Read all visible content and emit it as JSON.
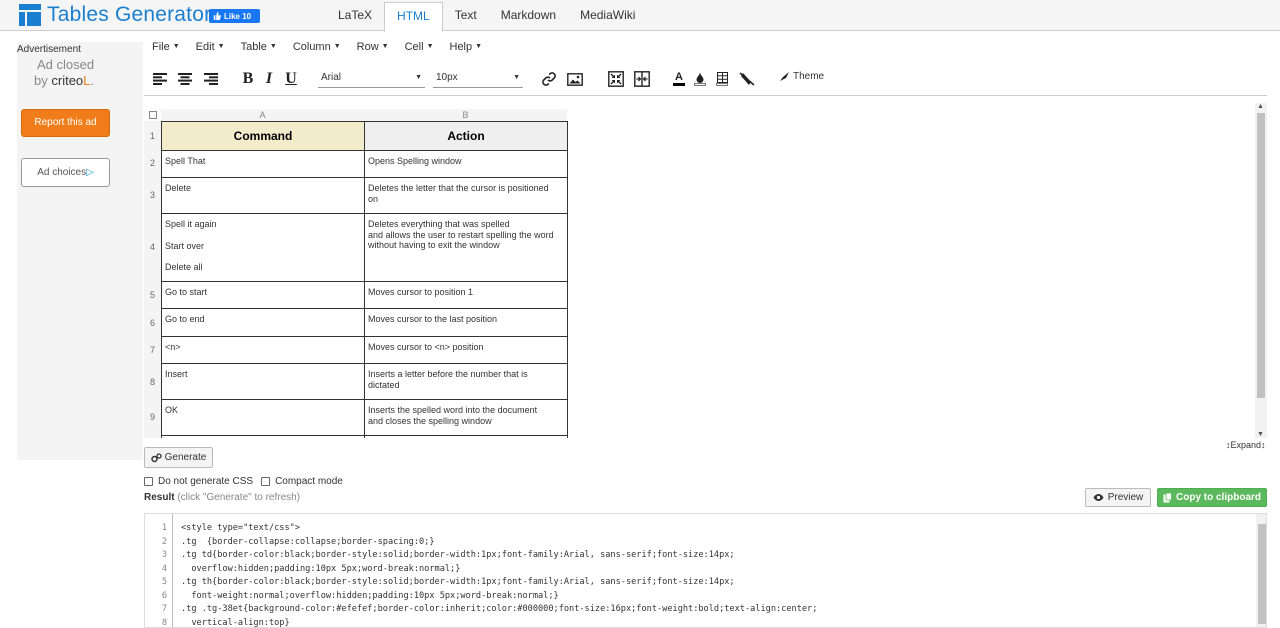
{
  "app": {
    "title": "Tables Generator",
    "like_label": "Like 10",
    "tabs": [
      {
        "label": "LaTeX",
        "active": false
      },
      {
        "label": "HTML",
        "active": true
      },
      {
        "label": "Text",
        "active": false
      },
      {
        "label": "Markdown",
        "active": false
      },
      {
        "label": "MediaWiki",
        "active": false
      }
    ]
  },
  "ad": {
    "title": "Advertisement",
    "closed": "Ad closed",
    "by": "by",
    "brand": "criteo",
    "report": "Report this ad",
    "choices": "Ad choices"
  },
  "menu": [
    "File",
    "Edit",
    "Table",
    "Column",
    "Row",
    "Cell",
    "Help"
  ],
  "toolbar": {
    "font": "Arial",
    "size": "10px",
    "theme": "Theme",
    "icons": [
      "align-left-icon",
      "align-center-icon",
      "align-right-icon",
      "bold-icon",
      "italic-icon",
      "underline-icon",
      "link-icon",
      "image-icon",
      "merge-cells-icon",
      "split-cells-icon",
      "text-color-icon",
      "fill-color-icon",
      "border-icon",
      "clear-format-icon",
      "theme-icon"
    ],
    "bold": "B",
    "italic": "I",
    "underline": "U",
    "text_color": "A"
  },
  "sheet": {
    "columns": [
      "A",
      "B"
    ],
    "rows": [
      {
        "num": "1",
        "a": "Command",
        "b": "Action"
      },
      {
        "num": "2",
        "a": "Spell That",
        "b": "Opens Spelling window"
      },
      {
        "num": "3",
        "a": "Delete",
        "b": "Deletes the letter that the cursor is positioned on"
      },
      {
        "num": "4",
        "a_lines": [
          "Spell it again",
          "Start over",
          "Delete all"
        ],
        "b": "Deletes everything that was spelled and allows the user to restart spelling the word without having to exit the window"
      },
      {
        "num": "5",
        "a": "Go to start",
        "b": "Moves cursor to position 1"
      },
      {
        "num": "6",
        "a": "Go to end",
        "b": "Moves cursor to the last position"
      },
      {
        "num": "7",
        "a": "<n>",
        "b": "Moves cursor to <n> position"
      },
      {
        "num": "8",
        "a": "Insert",
        "b": "Inserts a letter before the number that is dictated"
      },
      {
        "num": "9",
        "a": "OK",
        "b": "Inserts the spelled word into the document and closes the spelling window"
      }
    ],
    "row4_b_lines": [
      "Deletes everything that was spelled",
      "and allows the user to restart spelling the word",
      "without having to exit the window"
    ],
    "row3_b_lines": [
      "Deletes the letter that the cursor is positioned",
      "on"
    ],
    "row8_b_lines": [
      "Inserts a letter before the number that is",
      "dictated"
    ],
    "row9_b_lines": [
      "Inserts the spelled word into the document",
      "and closes the spelling window"
    ]
  },
  "expand": "Expand",
  "generate": "Generate",
  "options": {
    "no_css": "Do not generate CSS",
    "compact": "Compact mode"
  },
  "result": {
    "label": "Result",
    "hint": "(click \"Generate\" to refresh)"
  },
  "buttons": {
    "preview": "Preview",
    "copy": "Copy to clipboard"
  },
  "code_lines": [
    {
      "n": "1",
      "t": "<style type=\"text/css\">"
    },
    {
      "n": "2",
      "t": ".tg  {border-collapse:collapse;border-spacing:0;}"
    },
    {
      "n": "3",
      "t": ".tg td{border-color:black;border-style:solid;border-width:1px;font-family:Arial, sans-serif;font-size:14px;"
    },
    {
      "n": "4",
      "t": "  overflow:hidden;padding:10px 5px;word-break:normal;}"
    },
    {
      "n": "5",
      "t": ".tg th{border-color:black;border-style:solid;border-width:1px;font-family:Arial, sans-serif;font-size:14px;"
    },
    {
      "n": "6",
      "t": "  font-weight:normal;overflow:hidden;padding:10px 5px;word-break:normal;}"
    },
    {
      "n": "7",
      "t": ".tg .tg-38et{background-color:#efefef;border-color:inherit;color:#000000;font-size:16px;font-weight:bold;text-align:center;"
    },
    {
      "n": "8",
      "t": "  vertical-align:top}"
    }
  ],
  "colors": {
    "brand": "#1a7fd1",
    "report": "#f07d1a",
    "copy": "#5cb85c",
    "header_a": "#f2eccb",
    "header_b": "#efefef"
  }
}
